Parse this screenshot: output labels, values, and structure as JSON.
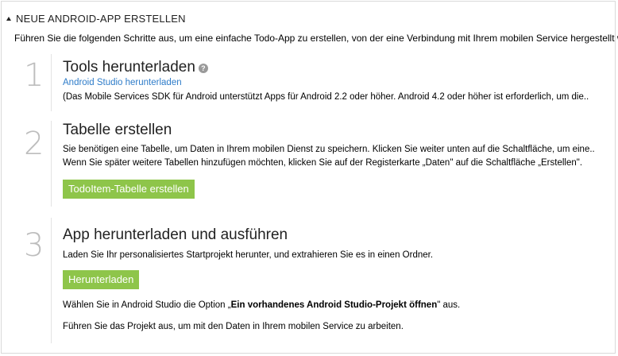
{
  "header": {
    "title": "NEUE ANDROID-APP ERSTELLEN"
  },
  "intro": "Führen Sie die folgenden Schritte aus, um eine einfache Todo-App zu erstellen, von der eine Verbindung mit Ihrem mobilen Service hergestellt wird.",
  "steps": [
    {
      "number": "1",
      "title": "Tools herunterladen",
      "help_icon": "?",
      "link": "Android Studio herunterladen",
      "note": "(Das Mobile Services SDK für Android unterstützt Apps für Android 2.2 oder höher. Android 4.2 oder höher ist erforderlich, um die.."
    },
    {
      "number": "2",
      "title": "Tabelle erstellen",
      "line1": "Sie benötigen eine Tabelle, um Daten in Ihrem mobilen Dienst zu speichern. Klicken Sie weiter unten auf die Schaltfläche, um eine..",
      "line2": "Wenn Sie später weitere Tabellen hinzufügen möchten, klicken Sie auf der Registerkarte „Daten\" auf die Schaltfläche „Erstellen\".",
      "button": "TodoItem-Tabelle erstellen"
    },
    {
      "number": "3",
      "title": "App herunterladen und ausführen",
      "line1": "Laden Sie Ihr personalisiertes Startprojekt herunter, und extrahieren Sie es in einen Ordner.",
      "button": "Herunterladen",
      "line2_prefix": "Wählen Sie in Android Studio die Option „",
      "line2_bold": "Ein vorhandenes Android Studio-Projekt öffnen",
      "line2_suffix": "\" aus.",
      "line3": "Führen Sie das Projekt aus, um mit den Daten in Ihrem mobilen Service zu arbeiten."
    }
  ]
}
